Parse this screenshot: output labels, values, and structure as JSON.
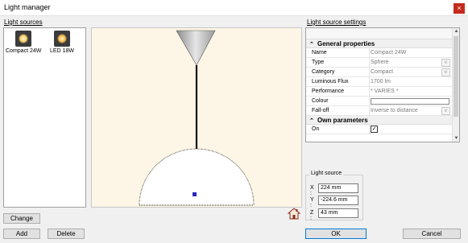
{
  "window": {
    "title": "Light manager",
    "close_glyph": "×"
  },
  "left": {
    "section_label": "Light sources",
    "sources": [
      {
        "label": "Compact 24W",
        "icon": "compact-bulb-icon",
        "glow": "#ffe08a"
      },
      {
        "label": "LED 18W",
        "icon": "led-bulb-icon",
        "glow": "#ffcc66"
      }
    ],
    "change_label": "Change",
    "add_label": "Add",
    "delete_label": "Delete"
  },
  "settings": {
    "section_label": "Light source settings",
    "general_header": "General properties",
    "own_header": "Own parameters",
    "rows": [
      {
        "key": "Name",
        "value": "Compact 24W"
      },
      {
        "key": "Type",
        "value": "Sphere"
      },
      {
        "key": "Category",
        "value": "Compact"
      },
      {
        "key": "Luminous Flux",
        "value": "1700 lm"
      },
      {
        "key": "Performance",
        "value": "* VARIES *"
      },
      {
        "key": "Colour",
        "value": ""
      },
      {
        "key": "Fall-off",
        "value": "Inverse to distance"
      }
    ],
    "own_rows": [
      {
        "key": "On",
        "checked_glyph": "✓"
      }
    ]
  },
  "light_source": {
    "legend": "Light source",
    "x_label": "X :",
    "x_value": "224 mm",
    "y_label": "Y :",
    "y_value": "-224.6 mm",
    "z_label": "Z :",
    "z_value": "43 mm"
  },
  "footer": {
    "ok_label": "OK",
    "cancel_label": "Cancel"
  },
  "colors": {
    "preview_bg": "#fdf6e6",
    "close_red": "#c42b1c",
    "marker_blue": "#2b2bb8"
  }
}
